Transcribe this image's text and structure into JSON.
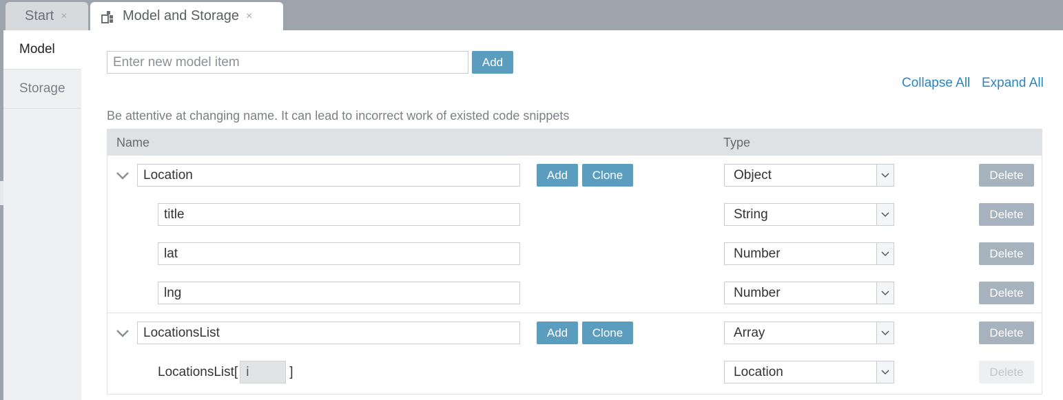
{
  "tabs": [
    {
      "label": "Start",
      "close": "×"
    },
    {
      "label": "Model and Storage",
      "close": "×"
    }
  ],
  "sidebar": {
    "items": [
      {
        "label": "Model"
      },
      {
        "label": "Storage"
      }
    ]
  },
  "new_item": {
    "placeholder": "Enter new model item",
    "add_label": "Add"
  },
  "links": {
    "collapse_all": "Collapse All",
    "expand_all": "Expand All"
  },
  "warning": "Be attentive at changing name. It can lead to incorrect work of existed code snippets",
  "table": {
    "headers": {
      "name": "Name",
      "type": "Type"
    },
    "groups": [
      {
        "name": "Location",
        "type": "Object",
        "add_label": "Add",
        "clone_label": "Clone",
        "delete_label": "Delete",
        "children": [
          {
            "name": "title",
            "type": "String",
            "delete_label": "Delete"
          },
          {
            "name": "lat",
            "type": "Number",
            "delete_label": "Delete"
          },
          {
            "name": "lng",
            "type": "Number",
            "delete_label": "Delete"
          }
        ]
      },
      {
        "name": "LocationsList",
        "type": "Array",
        "add_label": "Add",
        "clone_label": "Clone",
        "delete_label": "Delete",
        "item": {
          "prefix": "LocationsList[",
          "index": "i",
          "suffix": "]",
          "type": "Location",
          "delete_label": "Delete"
        }
      }
    ]
  }
}
